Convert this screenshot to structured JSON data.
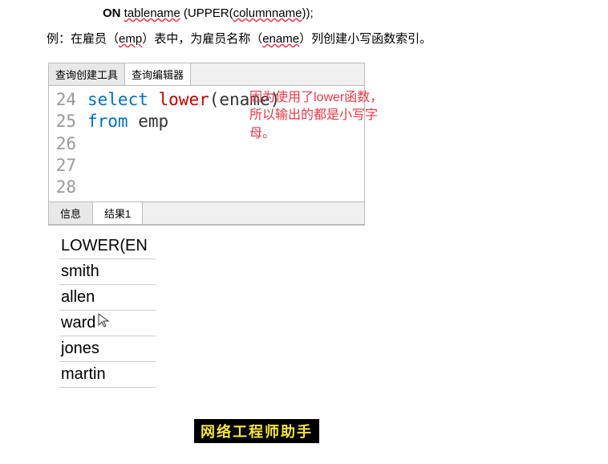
{
  "top_line": {
    "kw": "ON",
    "tablename": "tablename",
    "mid": " (UPPER(",
    "colname": "columnname",
    "end": "));"
  },
  "example": {
    "prefix": "例：在雇员（",
    "emp": "emp",
    "mid": "）表中，为雇员名称（",
    "ename": "ename",
    "suffix": "）列创建小写函数索引。"
  },
  "tabs": {
    "builder": "查询创建工具",
    "editor": "查询编辑器"
  },
  "gutter": [
    "24",
    "25",
    "26",
    "27",
    "28"
  ],
  "code": {
    "l1_kw": "select ",
    "l1_fn": "lower",
    "l1_rest": "(ename)",
    "l2_kw": "from ",
    "l2_rest": "emp"
  },
  "annotation": "因为使用了lower函数，所以输出的都是小写字母。",
  "result_tabs": {
    "info": "信息",
    "result1": "结果1"
  },
  "result": {
    "header": "LOWER(EN",
    "rows": [
      "smith",
      "allen",
      "ward",
      "jones",
      "martin"
    ]
  },
  "watermark": "网络工程师助手"
}
